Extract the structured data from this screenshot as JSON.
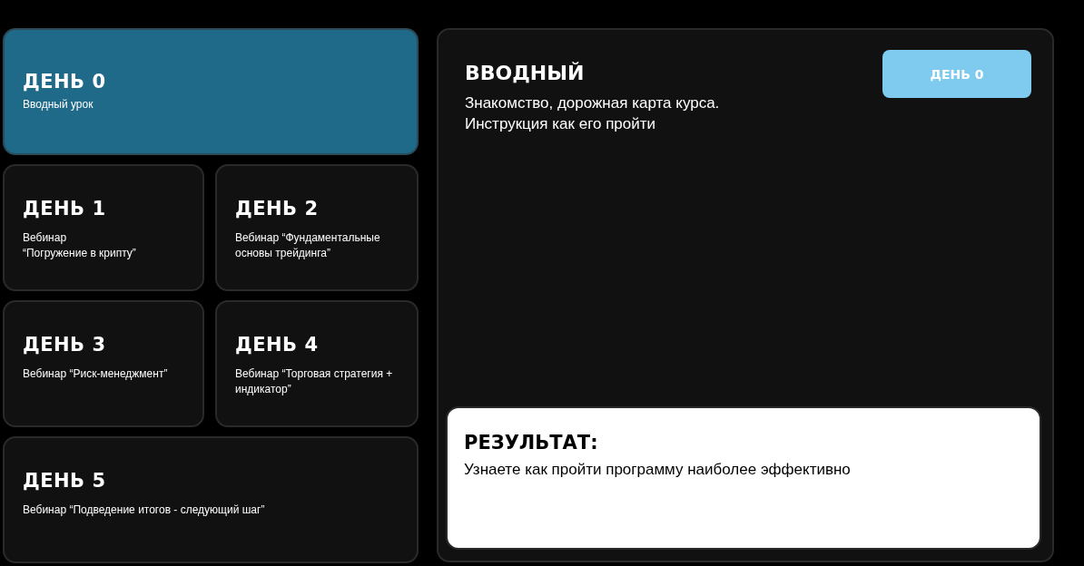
{
  "days": [
    {
      "title": "ДЕНЬ 0",
      "subtitle": "Вводный урок",
      "selected": true
    },
    {
      "title": "ДЕНЬ 1",
      "subtitle": "Вебинар\n“Погружение в крипту”",
      "selected": false
    },
    {
      "title": "ДЕНЬ 2",
      "subtitle": "Вебинар “Фундаментальные\nосновы трейдинга”",
      "selected": false
    },
    {
      "title": "ДЕНЬ 3",
      "subtitle": "Вебинар “Риск-менеджмент”",
      "selected": false
    },
    {
      "title": "ДЕНЬ 4",
      "subtitle": "Вебинар “Торговая стратегия +\nиндикатор”",
      "selected": false
    },
    {
      "title": "ДЕНЬ 5",
      "subtitle": "Вебинар “Подведение итогов - следующий шаг”",
      "selected": false
    }
  ],
  "detail": {
    "title": "ВВОДНЫЙ",
    "description": "Знакомство, дорожная карта курса.\nИнструкция как его пройти",
    "day_button": "ДЕНЬ 0",
    "result": {
      "title": "РЕЗУЛЬТАТ:",
      "text": "Узнаете как пройти программу наиболее эффективно"
    }
  }
}
